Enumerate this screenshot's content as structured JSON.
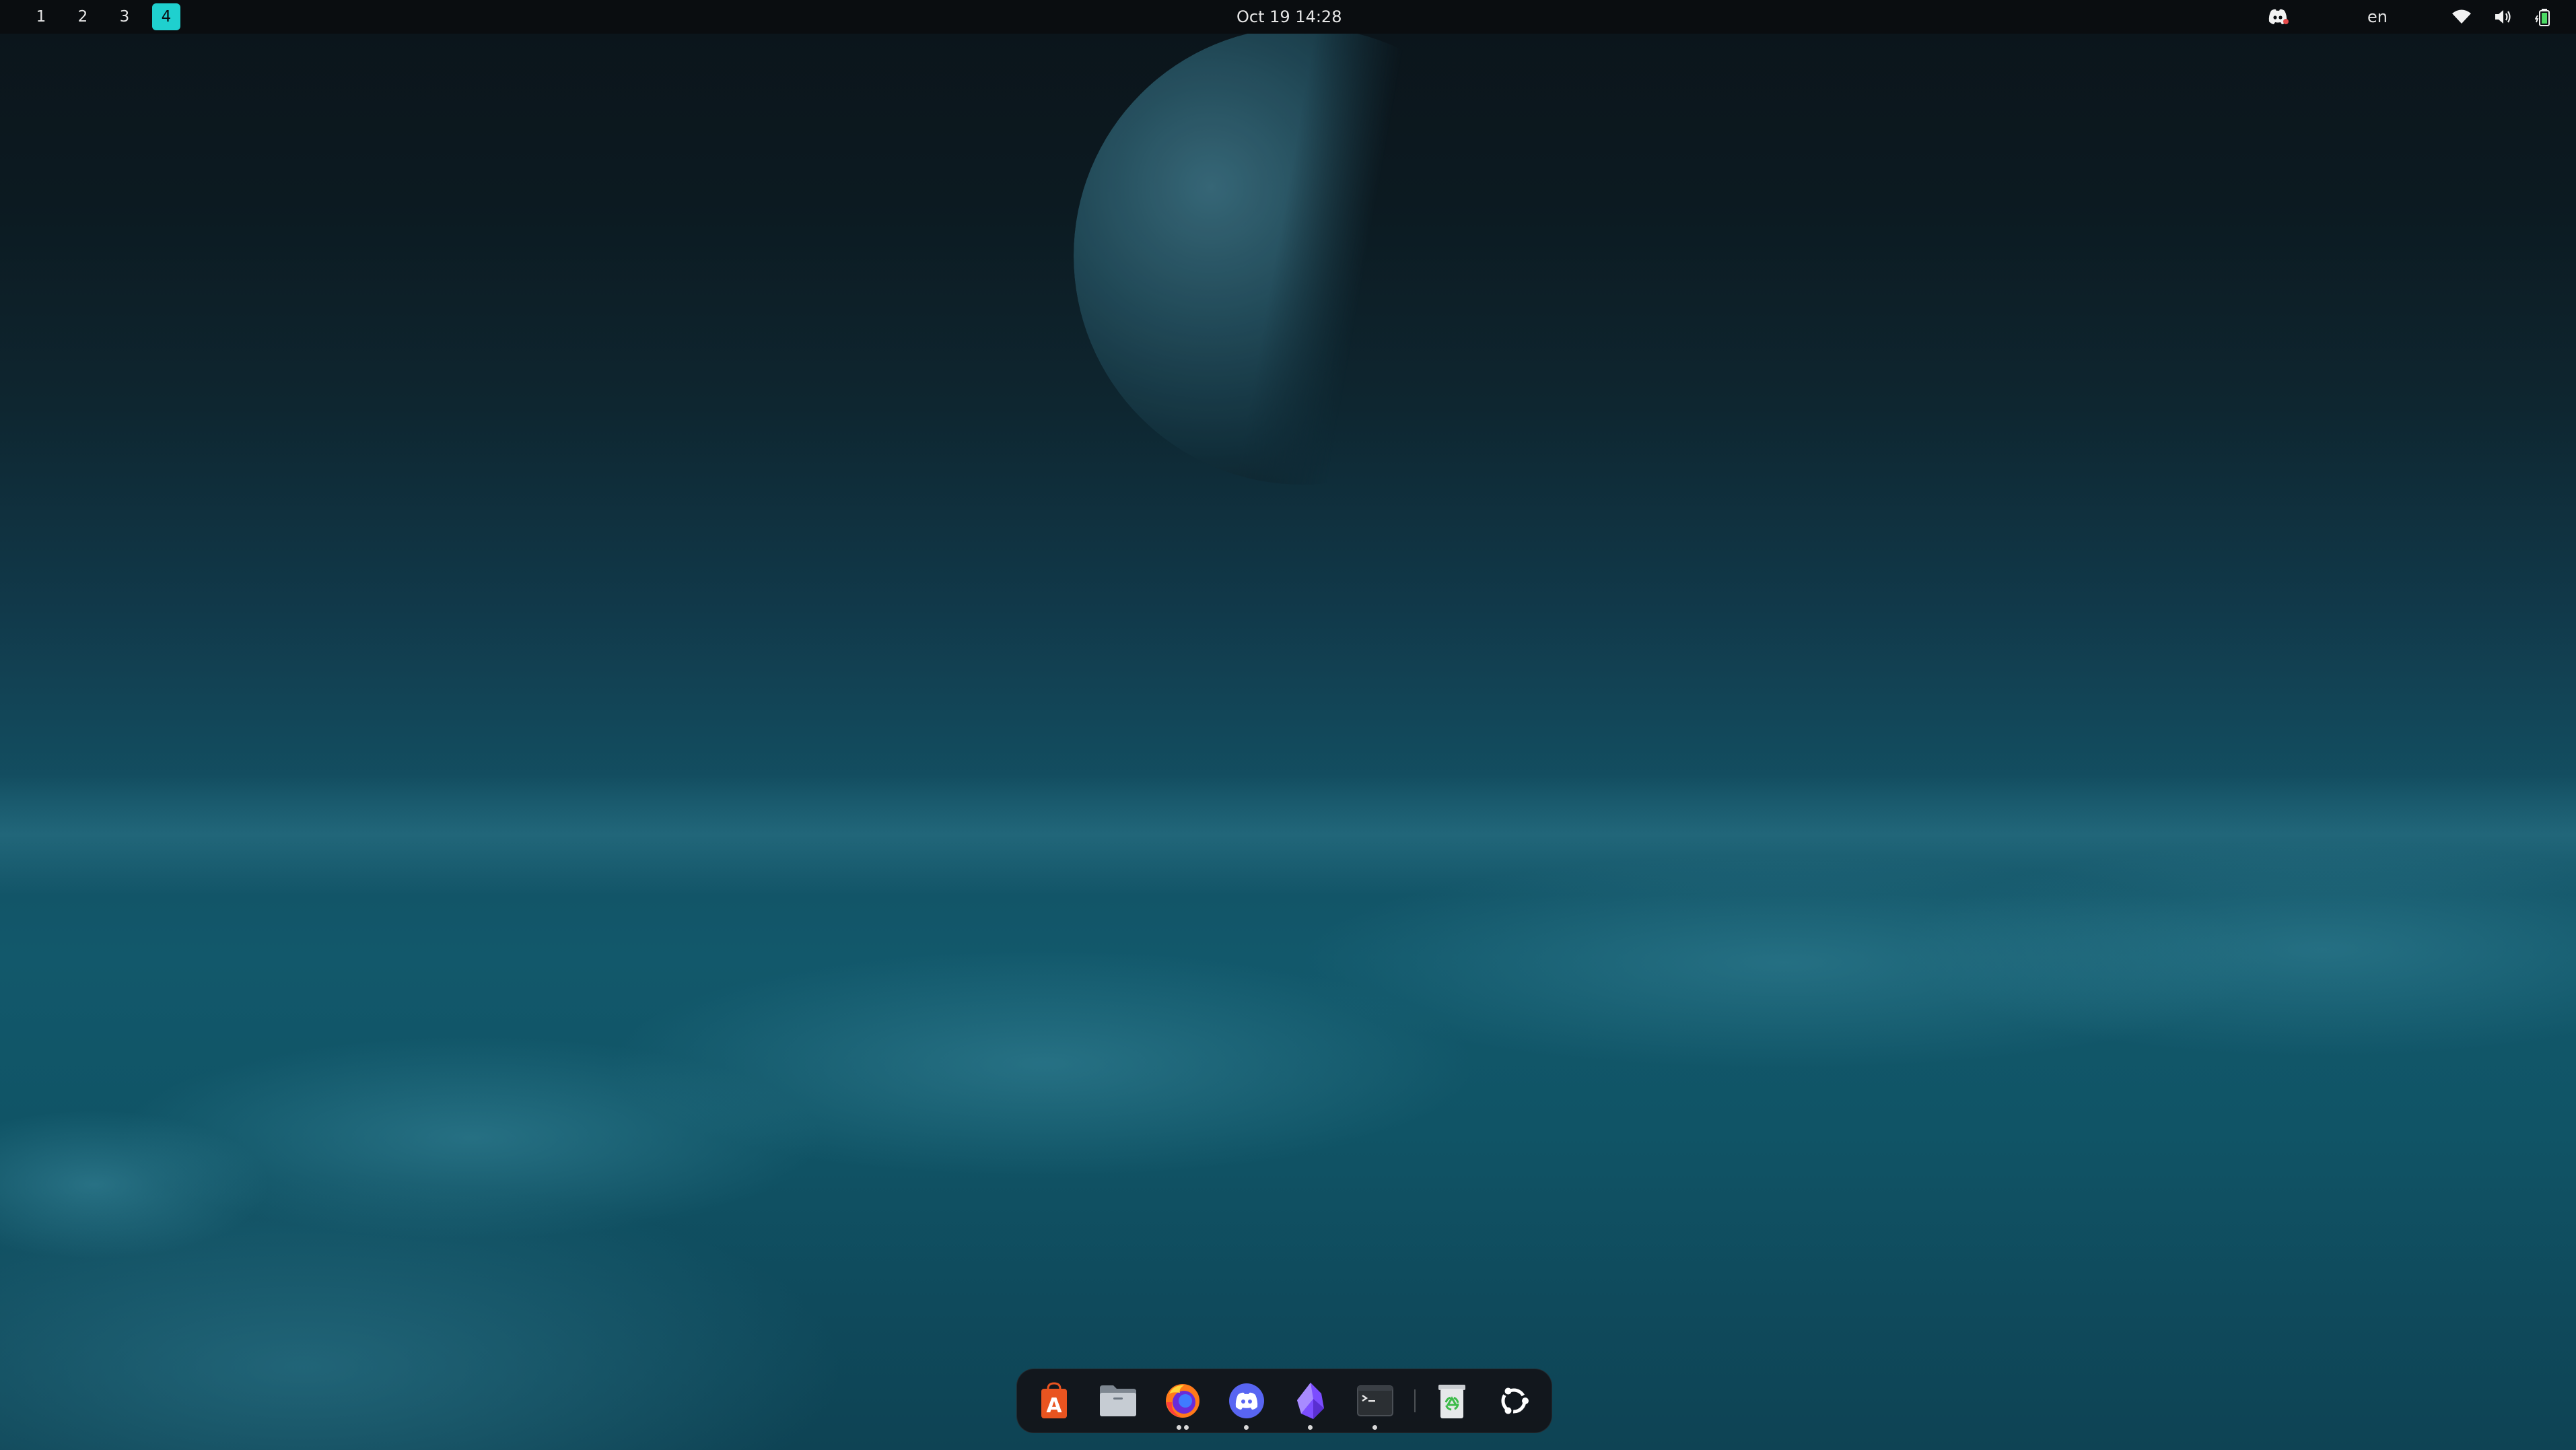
{
  "topbar": {
    "workspaces": [
      "1",
      "2",
      "3",
      "4"
    ],
    "active_workspace": "4",
    "clock": "Oct 19  14:28",
    "language": "en",
    "tray_icons": [
      "discord-tray-icon",
      "wifi-icon",
      "volume-icon",
      "battery-icon"
    ]
  },
  "dock": {
    "apps": [
      {
        "name": "software-center",
        "icon": "app-store-icon"
      },
      {
        "name": "files",
        "icon": "folder-icon"
      },
      {
        "name": "firefox",
        "icon": "firefox-icon"
      },
      {
        "name": "discord",
        "icon": "discord-icon"
      },
      {
        "name": "obsidian",
        "icon": "obsidian-icon"
      },
      {
        "name": "terminal",
        "icon": "terminal-icon"
      },
      {
        "name": "trash",
        "icon": "trash-icon"
      },
      {
        "name": "show-apps",
        "icon": "ubuntu-logo-icon"
      }
    ]
  },
  "colors": {
    "accent": "#1fd0cf",
    "topbar_bg": "#0a0d10",
    "dock_bg": "#121418",
    "software_orange": "#e95420",
    "discord_blurple": "#5865f2",
    "obsidian_purple": "#7c4dff"
  }
}
